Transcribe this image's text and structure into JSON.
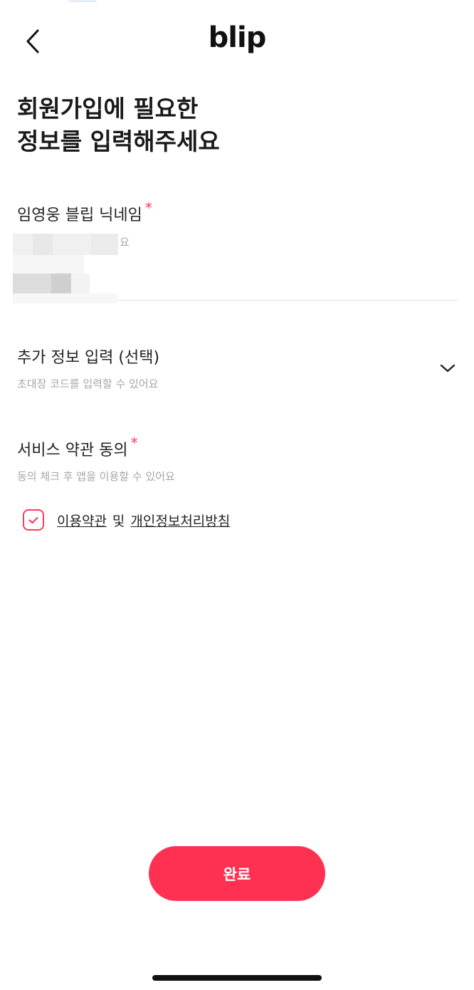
{
  "header": {
    "logo_text": "blip",
    "back_icon": "chevron-left-icon"
  },
  "title": {
    "line1": "회원가입에 필요한",
    "line2": "정보를 입력해주세요"
  },
  "nickname": {
    "label": "임영웅 블립 닉네임",
    "required_mark": "*",
    "hint_suffix": "요",
    "value": ""
  },
  "extra_info": {
    "label": "추가 정보 입력 (선택)",
    "help": "초대장 코드를 입력할 수 있어요",
    "expand_icon": "chevron-down-icon"
  },
  "terms": {
    "label": "서비스 약관 동의",
    "required_mark": "*",
    "help": "동의 체크 후 앱을 이용할 수 있어요",
    "checked": true,
    "check_icon": "checkmark-icon",
    "terms_link": "이용약관",
    "conjunction": "및",
    "privacy_link": "개인정보처리방침"
  },
  "submit": {
    "label": "완료"
  },
  "colors": {
    "accent": "#ff3152",
    "required": "#ff3b5c",
    "help_text": "#a6a6a6",
    "divider": "#e2e2e2"
  }
}
